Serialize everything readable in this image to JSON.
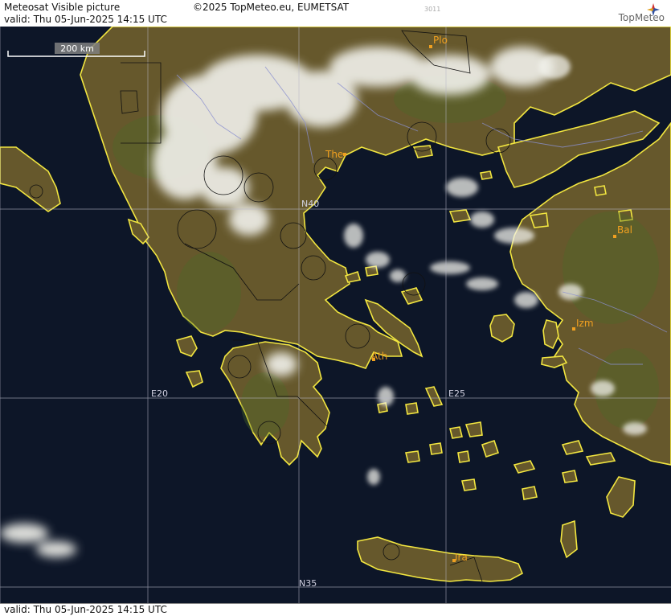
{
  "header": {
    "title": "Meteosat Visible picture",
    "valid": "valid:  Thu  05-Jun-2025  14:15 UTC",
    "copyright": "©2025 TopMeteo.eu, EUMETSAT",
    "image_code": "3011",
    "logo_text": "TopMeteo"
  },
  "footer": {
    "valid": "valid:  Thu  05-Jun-2025  14:15 UTC"
  },
  "scale": {
    "label": "200 km"
  },
  "grid_labels": {
    "lat_40": "N40",
    "lat_35": "N35",
    "lon_20": "E20",
    "lon_25": "E25"
  },
  "cities": {
    "plovdiv": "Plo",
    "thessaloniki": "The",
    "athens": "Ath",
    "balikesir": "Bal",
    "izmir": "Izm",
    "iraklion": "Ira"
  },
  "colors": {
    "sea": "#0d1628",
    "land": "#6a5a2c",
    "coast_border": "#f2e640",
    "city": "#f0a020",
    "cloud": "#f2f2ec"
  }
}
